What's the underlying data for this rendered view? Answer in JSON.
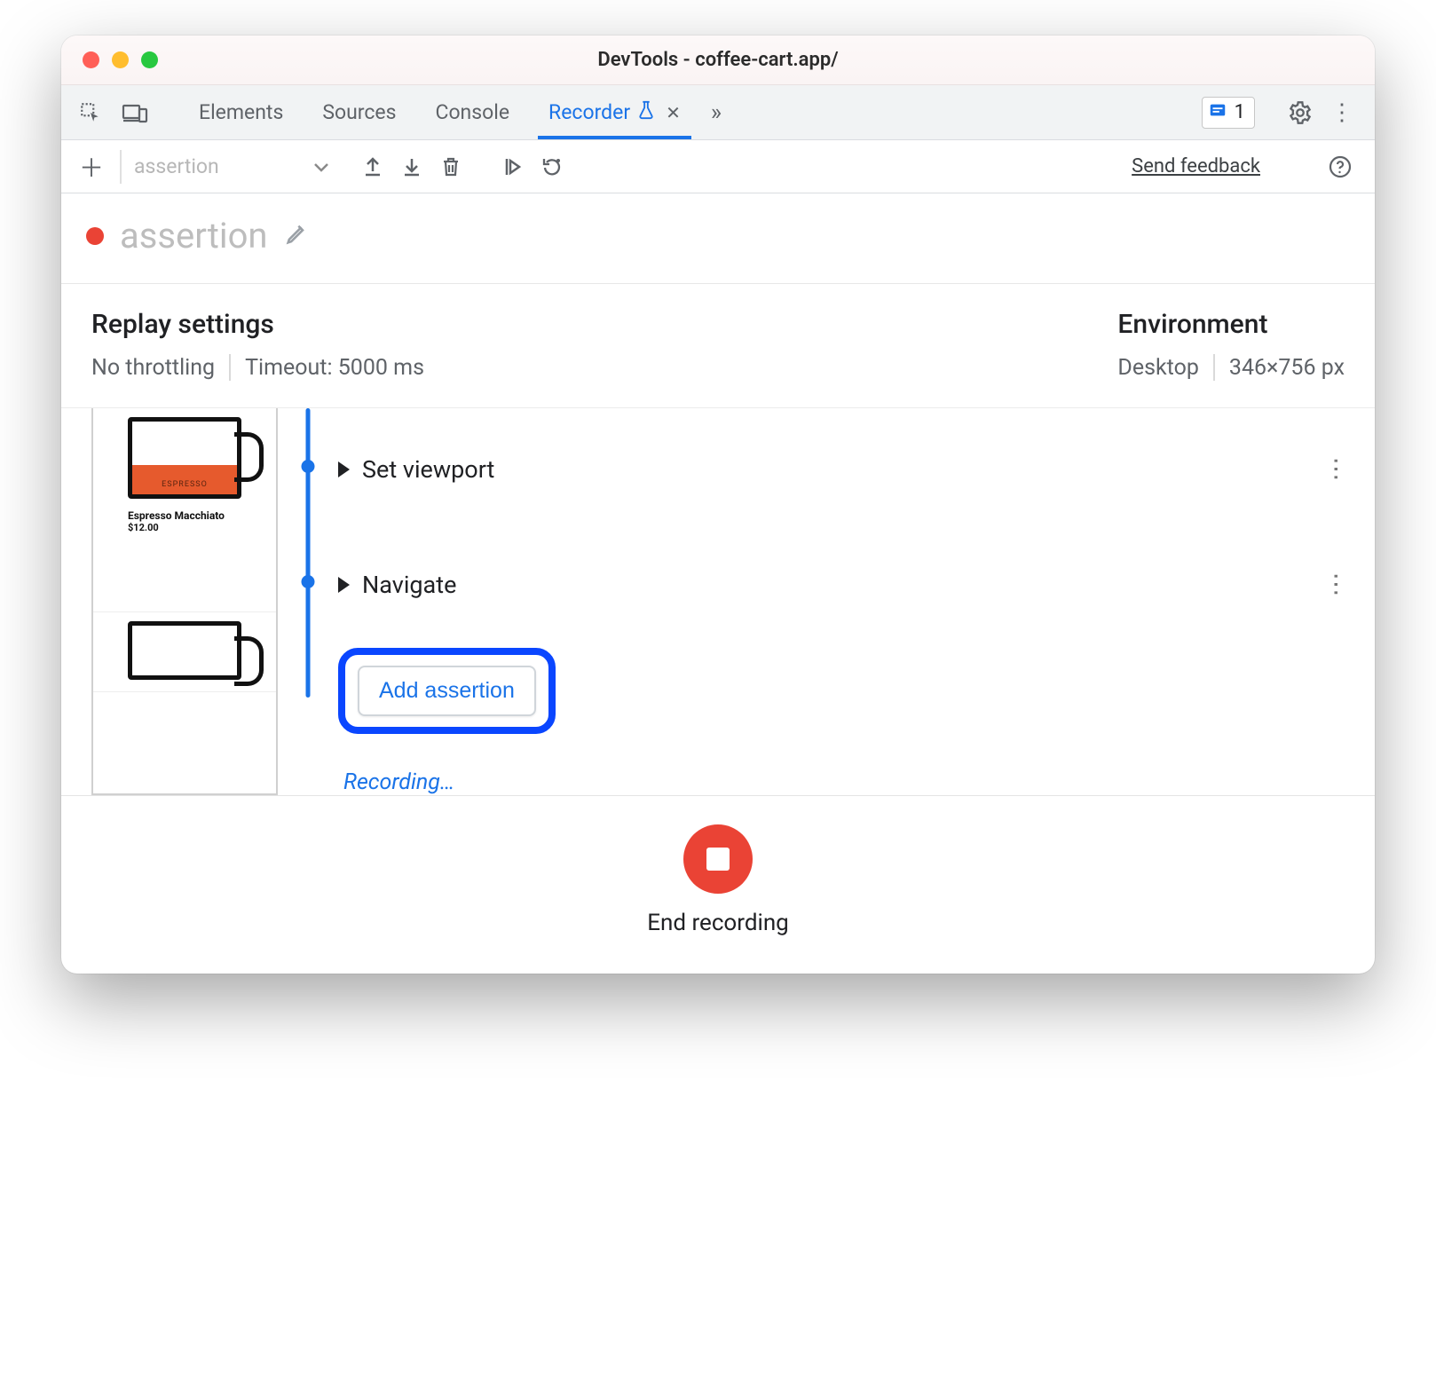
{
  "window": {
    "title": "DevTools - coffee-cart.app/"
  },
  "tabs": {
    "items": [
      "Elements",
      "Sources",
      "Console",
      "Recorder"
    ],
    "active": "Recorder"
  },
  "issues": {
    "count": "1"
  },
  "recorder_toolbar": {
    "selector_value": "assertion",
    "feedback": "Send feedback"
  },
  "recording": {
    "title": "assertion",
    "status_label": "Recording…"
  },
  "replay_settings": {
    "heading": "Replay settings",
    "throttling": "No throttling",
    "timeout": "Timeout: 5000 ms"
  },
  "environment": {
    "heading": "Environment",
    "device": "Desktop",
    "dimensions": "346×756 px"
  },
  "thumbnail": {
    "product": "Espresso Macchiato",
    "price": "$12.00",
    "cup_label": "ESPRESSO"
  },
  "steps": {
    "items": [
      {
        "label": "Set viewport"
      },
      {
        "label": "Navigate"
      }
    ]
  },
  "add_assertion": {
    "label": "Add assertion"
  },
  "end": {
    "label": "End recording"
  }
}
